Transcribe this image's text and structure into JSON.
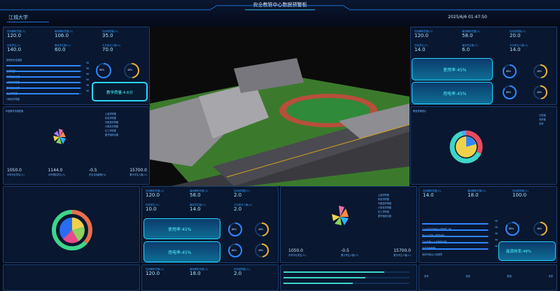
{
  "header": {
    "title": "安全教管中心数据预警板",
    "school": "江城大学",
    "datetime": "2025/6/6 01:47:50"
  },
  "colors": {
    "accent": "#2f86ff",
    "text": "#a8e2ff",
    "wave": "#4ff7ff",
    "bg": "#050b1a"
  },
  "left_top": {
    "stats": [
      {
        "label": "在岗教职员数(人)",
        "value": "120.0"
      },
      {
        "label": "离岗教职员数(人)",
        "value": "106.0"
      },
      {
        "label": "在岗领导数(人)",
        "value": "35.0"
      },
      {
        "label": "在校学生(人)",
        "value": "140.0"
      },
      {
        "label": "离校学生数(人)",
        "value": "60.0"
      },
      {
        "label": "今日来访人数(人)",
        "value": "70.0"
      }
    ],
    "list_title": "各院系安全指数",
    "list": [
      {
        "label": "工学院楼",
        "value": "98"
      },
      {
        "label": "体育馆综合楼",
        "value": "98"
      },
      {
        "label": "计算机学院楼",
        "value": "98"
      },
      {
        "label": "图书馆综合楼",
        "value": "98"
      },
      {
        "label": "化工学院楼",
        "value": "98"
      },
      {
        "label": "计算机学院楼",
        "value": "96"
      }
    ],
    "gauge1": "86%",
    "gauge2": "48%",
    "score": "教学质量:4.6分"
  },
  "left_mid": {
    "title": "年度教学资源配置",
    "legend": [
      "土建学院楼",
      "机电学院楼",
      "外国语学院楼",
      "计算机学院楼",
      "化工学院楼",
      "图书馆综合楼"
    ],
    "values": [
      "1050.0",
      "1144.0",
      "-0.5",
      "15700.0"
    ],
    "labels": [
      "中学毕业学生(人)",
      "今年预招学生(人)",
      "学生流动趋势(%)",
      "累计学生人数(人)"
    ]
  },
  "right_top": {
    "stats": [
      {
        "label": "在岗教职员数(人)",
        "value": "120.0"
      },
      {
        "label": "离岗教职员数(人)",
        "value": "58.0"
      },
      {
        "label": "在岗领导数(人)",
        "value": "20.0"
      },
      {
        "label": "在校学生(人)",
        "value": "14.0"
      },
      {
        "label": "离校学生数(人)",
        "value": "6.0"
      },
      {
        "label": "今日来访人数(人)",
        "value": "14.0"
      }
    ],
    "wave1": "使用率:45%",
    "wave2": "用电率:45%",
    "gauges": [
      "86%",
      "48%",
      "86%",
      "48%"
    ]
  },
  "right_mid": {
    "title": "教室排课统计",
    "legend": [
      "已排课",
      "未排课",
      "空闲"
    ]
  },
  "mid_left_panel": {
    "stats": [
      {
        "label": "在岗教职员数(人)",
        "value": "120.0"
      },
      {
        "label": "离岗教职员数(人)",
        "value": "58.0"
      },
      {
        "label": "在岗领导数(人)",
        "value": "2.0"
      },
      {
        "label": "在校学生(人)",
        "value": "10.0"
      },
      {
        "label": "离校学生数(人)",
        "value": "14.0"
      },
      {
        "label": "今日来访人数(人)",
        "value": "2.0"
      }
    ],
    "wave1": "使用率:45%",
    "wave2": "用电率:45%",
    "gauges": [
      "86%",
      "48%",
      "86%",
      "48%"
    ]
  },
  "mid_right_panel": {
    "legend": [
      "土建学院楼",
      "机电学院楼",
      "外国语学院楼",
      "计算机学院楼",
      "化工学院楼",
      "图书馆综合楼"
    ],
    "values": [
      "1050.0",
      "-0.5",
      "15700.0"
    ],
    "labels": [
      "中学毕业学生(人)",
      "累计学生人数(人)",
      "累计学生人数(人)"
    ],
    "stats": [
      {
        "label": "在岗教职员数(人)",
        "value": "14.0"
      },
      {
        "label": "离岗教职员数(人)",
        "value": "18.0"
      },
      {
        "label": "在岗领导数(人)",
        "value": "100.0"
      }
    ],
    "list": [
      {
        "label": "广州市南方医科大学附属二院",
        "value": "98"
      },
      {
        "label": "郑州大学第一附属医院",
        "value": "98"
      },
      {
        "label": "广州市第一人民医院分院",
        "value": "98"
      },
      {
        "label": "北京协和医院",
        "value": "98"
      },
      {
        "label": "深圳市南山人民医院",
        "value": "98"
      }
    ],
    "gauges": [
      "86%",
      "48%"
    ],
    "wave": "能源效率:48%"
  },
  "bottom_row": {
    "stats": [
      {
        "label": "在岗教职员数(人)",
        "value": "120.0"
      },
      {
        "label": "离岗教职员数(人)",
        "value": "18.0"
      },
      {
        "label": "在岗领导数(人)",
        "value": "2.0"
      }
    ],
    "table_headers": [
      "序号",
      "名称",
      "数量",
      "状态"
    ]
  }
}
